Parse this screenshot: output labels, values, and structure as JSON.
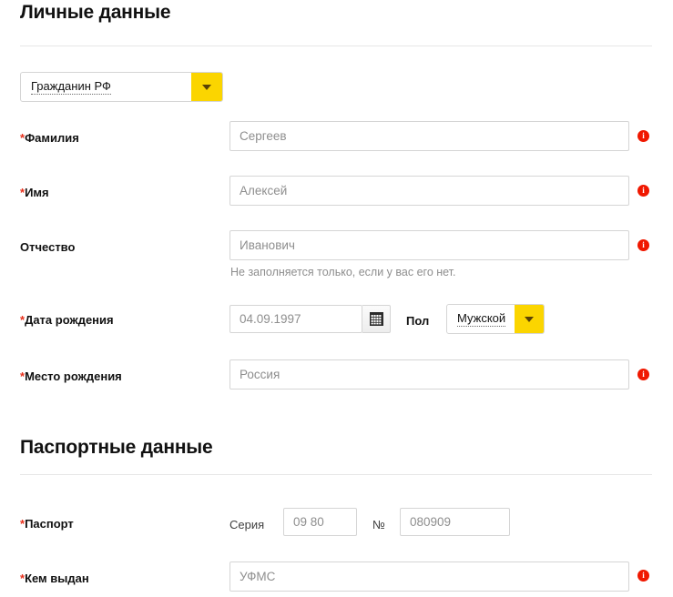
{
  "sections": [
    {
      "title": "Личные данные"
    },
    {
      "title": "Паспортные данные"
    }
  ],
  "citizenship": {
    "label_value": "Гражданин РФ",
    "arrow_icon": "chevron-down-icon"
  },
  "fields": {
    "last_name": {
      "label": "Фамилия",
      "required_marker": "*",
      "value": "Сергеев",
      "placeholder": "Сергеев",
      "info_icon": "info-icon",
      "info_glyph": "i"
    },
    "first_name": {
      "label": "Имя",
      "required_marker": "*",
      "value": "Алексей",
      "placeholder": "Алексей",
      "info_icon": "info-icon",
      "info_glyph": "i"
    },
    "middle_name": {
      "label": "Отчество",
      "required_marker": "",
      "value": "Иванович",
      "placeholder": "Иванович",
      "hint": "Не заполняется только, если у вас его нет.",
      "info_icon": "info-icon",
      "info_glyph": "i"
    },
    "birth_date": {
      "label": "Дата рождения",
      "required_marker": "*",
      "value": "04.09.1997",
      "placeholder": "04.09.1997",
      "calendar_icon": "calendar-icon"
    },
    "gender": {
      "label": "Пол",
      "value": "Мужской",
      "arrow_icon": "chevron-down-icon"
    },
    "birth_place": {
      "label": "Место рождения",
      "required_marker": "*",
      "value": "Россия",
      "placeholder": "Россия",
      "info_icon": "info-icon",
      "info_glyph": "i"
    },
    "passport": {
      "label": "Паспорт",
      "required_marker": "*",
      "series_label": "Серия",
      "series_value": "09 80",
      "series_placeholder": "09 80",
      "number_label": "№",
      "number_value": "080909",
      "number_placeholder": "080909"
    },
    "issued_by": {
      "label": "Кем выдан",
      "required_marker": "*",
      "value": "УФМС",
      "placeholder": "УФМС",
      "info_icon": "info-icon",
      "info_glyph": "i"
    }
  },
  "colors": {
    "accent_yellow": "#fbd500",
    "required_red": "#e8301b",
    "info_red": "#f01800",
    "border_gray": "#d5d5d5",
    "placeholder_gray": "#8e8e8e",
    "divider_gray": "#e6e6e6"
  }
}
